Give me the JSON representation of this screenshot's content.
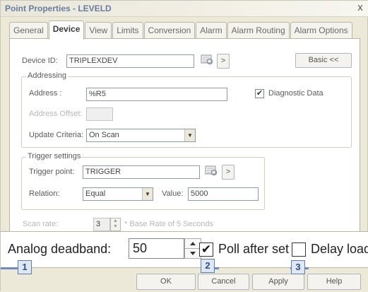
{
  "window": {
    "title": "Point Properties - LEVELD",
    "close_glyph": "x"
  },
  "tabs": [
    {
      "label": "General",
      "active": false
    },
    {
      "label": "Device",
      "active": true
    },
    {
      "label": "View",
      "active": false
    },
    {
      "label": "Limits",
      "active": false
    },
    {
      "label": "Conversion",
      "active": false
    },
    {
      "label": "Alarm",
      "active": false
    },
    {
      "label": "Alarm Routing",
      "active": false
    },
    {
      "label": "Alarm Options",
      "active": false
    }
  ],
  "device": {
    "device_id_label": "Device ID:",
    "device_id_value": "TRIPLEXDEV",
    "basic_button": "Basic <<",
    "browse_icon": "document-browse-icon",
    "next_glyph": ">"
  },
  "addressing": {
    "legend": "Addressing",
    "address_label": "Address :",
    "address_value": "%R5",
    "diagnostic_label": "Diagnostic Data",
    "diagnostic_checked": true,
    "offset_label": "Address Offset:",
    "offset_value": "",
    "update_label": "Update Criteria:",
    "update_value": "On Scan"
  },
  "trigger": {
    "legend": "Trigger settings",
    "point_label": "Trigger point:",
    "point_value": "TRIGGER",
    "relation_label": "Relation:",
    "relation_value": "Equal",
    "value_label": "Value:",
    "value_value": "5000",
    "next_glyph": ">"
  },
  "scan": {
    "label": "Scan rate:",
    "value": "3",
    "note": "* Base Rate of 5 Seconds"
  },
  "zoom": {
    "deadband_label": "Analog deadband:",
    "deadband_value": "50",
    "poll_label": "Poll after set",
    "poll_checked": true,
    "delay_label": "Delay load",
    "delay_checked": false,
    "check_glyph": "✔"
  },
  "buttons": {
    "ok": "OK",
    "cancel": "Cancel",
    "apply": "Apply",
    "help": "Help"
  },
  "callouts": [
    "1",
    "2",
    "3"
  ],
  "colors": {
    "title_text": "#6b7d9e",
    "callout_fill": "#dfe7f3",
    "callout_border": "#5c7bb0"
  }
}
